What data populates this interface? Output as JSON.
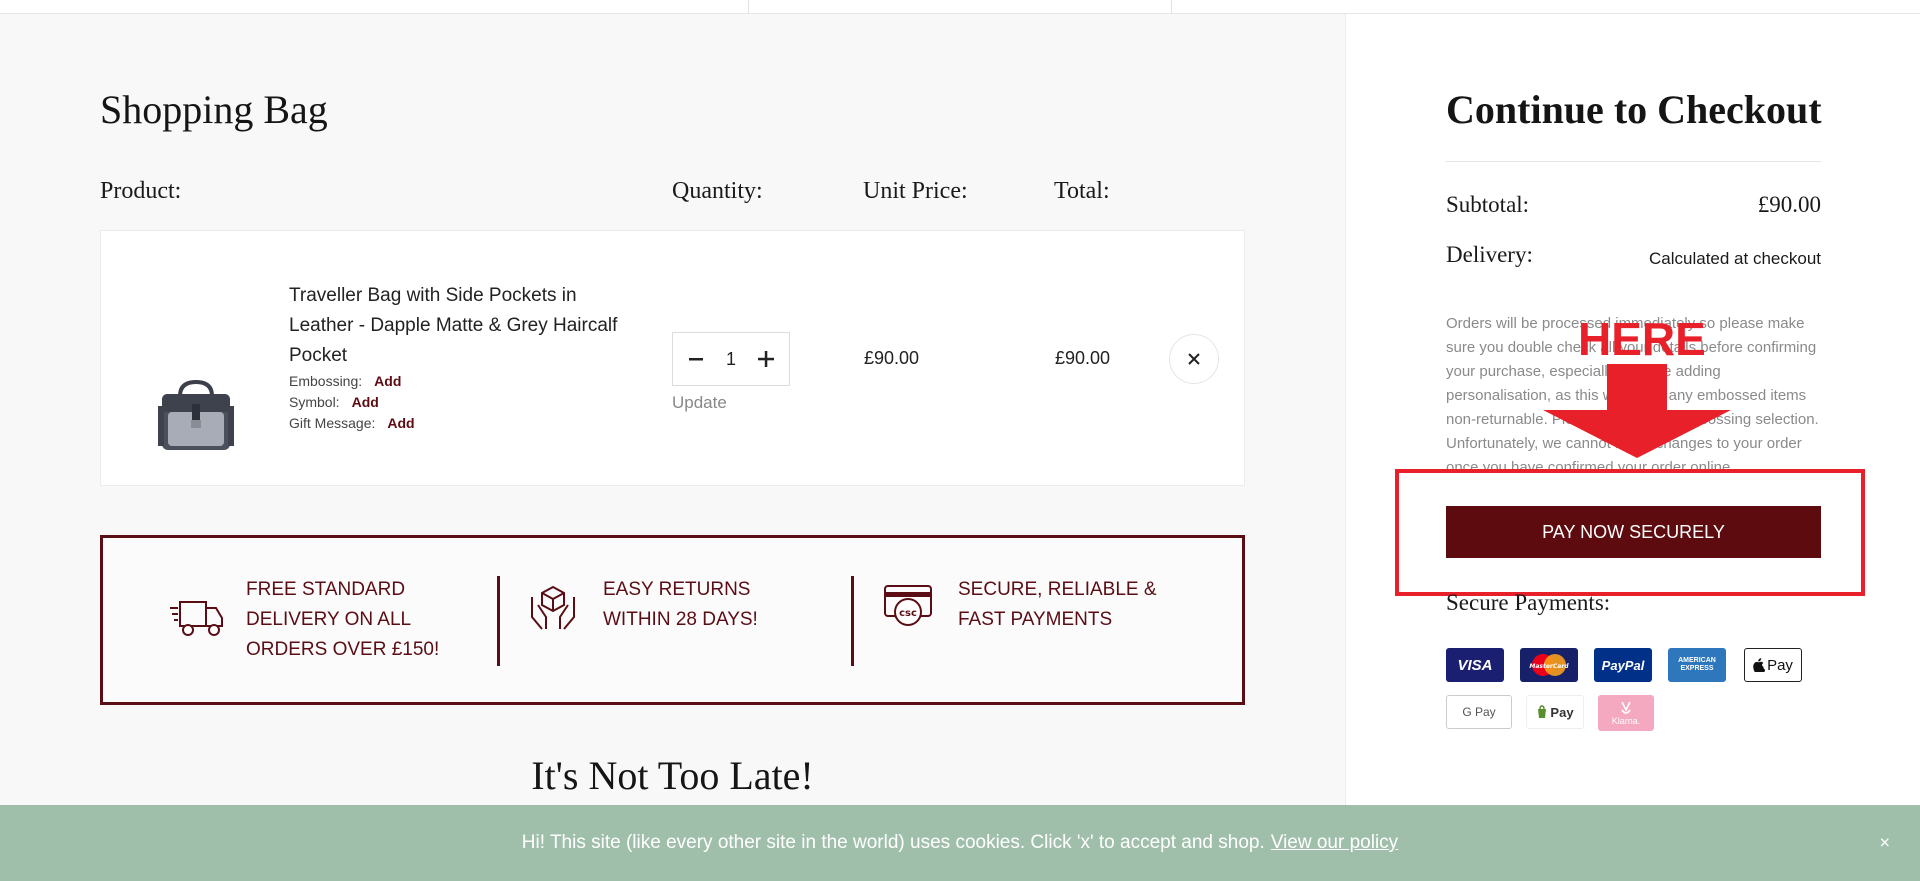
{
  "cart": {
    "title": "Shopping Bag",
    "columns": {
      "product": "Product:",
      "quantity": "Quantity:",
      "unit_price": "Unit Price:",
      "total": "Total:"
    },
    "item": {
      "name": "Traveller Bag with Side Pockets in Leather - Dapple Matte & Grey Haircalf Pocket",
      "options": [
        {
          "label": "Embossing:",
          "action": "Add"
        },
        {
          "label": "Symbol:",
          "action": "Add"
        },
        {
          "label": "Gift Message:",
          "action": "Add"
        }
      ],
      "quantity": "1",
      "update_label": "Update",
      "unit_price": "£90.00",
      "total": "£90.00"
    }
  },
  "features": [
    {
      "text": "FREE STANDARD DELIVERY ON ALL ORDERS OVER £150!",
      "icon": "delivery-truck-icon"
    },
    {
      "text": "EASY RETURNS WITHIN 28 DAYS!",
      "icon": "hands-box-icon"
    },
    {
      "text": "SECURE, RELIABLE & FAST PAYMENTS",
      "icon": "card-csc-icon"
    }
  ],
  "upsell": {
    "title": "It's Not Too Late!"
  },
  "checkout": {
    "title": "Continue to Checkout",
    "subtotal_label": "Subtotal:",
    "subtotal_value": "£90.00",
    "delivery_label": "Delivery:",
    "delivery_value": "Calculated at checkout",
    "note": "Orders will be processed immediately so please make sure you double check all your details before confirming your purchase, especially if you're adding personalisation, as this will make any embossed items non-returnable. Please check your embossing selection. Unfortunately, we cannot make changes to your order once you have confirmed your order online.",
    "pay_button": "PAY NOW SECURELY",
    "secure_label": "Secure Payments:",
    "payment_methods": [
      {
        "name": "VISA"
      },
      {
        "name": "MasterCard"
      },
      {
        "name": "PayPal"
      },
      {
        "name": "AMERICAN EXPRESS"
      },
      {
        "name": "Pay"
      },
      {
        "name": "G Pay"
      },
      {
        "name": "Pay"
      },
      {
        "name": "Klarna."
      }
    ]
  },
  "annotation": {
    "text": "HERE",
    "color": "#e8202a"
  },
  "cookie": {
    "text": "Hi! This site (like every other site in the world) uses cookies. Click 'x' to accept and shop.",
    "link": "View our policy",
    "close": "×"
  },
  "colors": {
    "brand": "#5e0b0f",
    "cookie_bg": "#9fbfaa"
  }
}
